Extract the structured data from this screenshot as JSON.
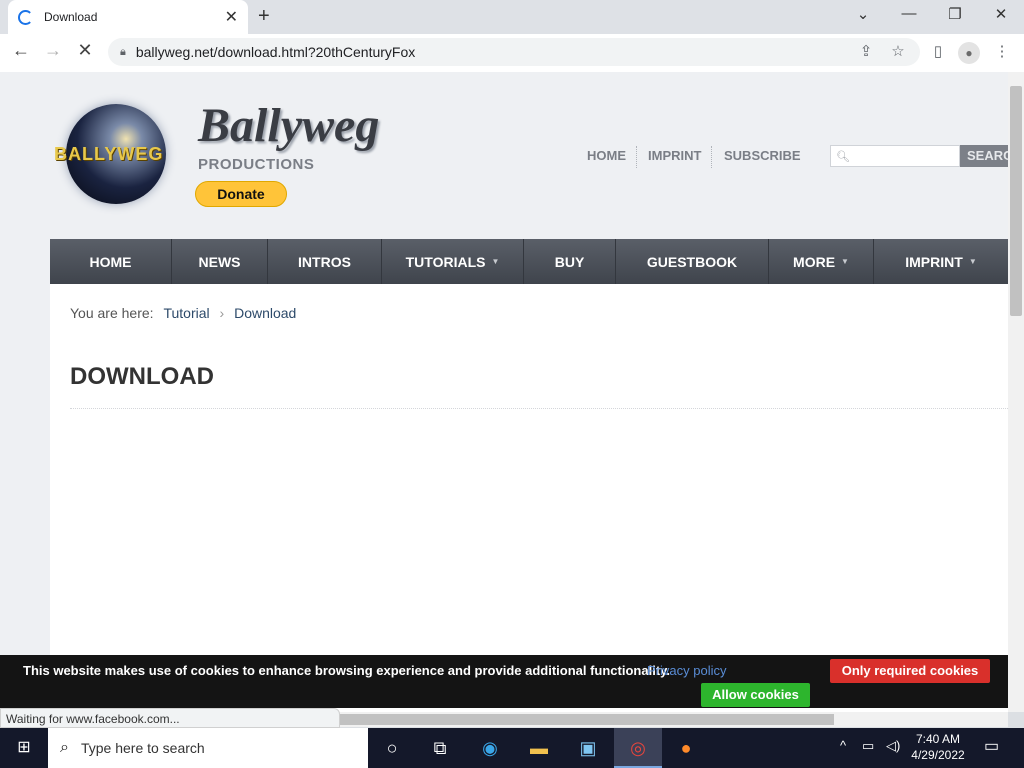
{
  "browser": {
    "tab_title": "Download",
    "tab_close": "✕",
    "new_tab": "+",
    "url": "ballyweg.net/download.html?20thCenturyFox",
    "status": "Waiting for www.facebook.com..."
  },
  "header": {
    "logo_text": "BALLYWEG",
    "brand": "Ballyweg",
    "brand_sub": "PRODUCTIONS",
    "donate": "Donate",
    "links": [
      "HOME",
      "IMPRINT",
      "SUBSCRIBE"
    ],
    "search_placeholder": "",
    "search_button": "SEARCH"
  },
  "nav": {
    "items": [
      {
        "label": "HOME",
        "dropdown": false
      },
      {
        "label": "NEWS",
        "dropdown": false
      },
      {
        "label": "INTROS",
        "dropdown": false
      },
      {
        "label": "TUTORIALS",
        "dropdown": true
      },
      {
        "label": "BUY",
        "dropdown": false
      },
      {
        "label": "GUESTBOOK",
        "dropdown": false
      },
      {
        "label": "MORE",
        "dropdown": true
      },
      {
        "label": "IMPRINT",
        "dropdown": true
      }
    ]
  },
  "breadcrumb": {
    "prefix": "You are here:",
    "items": [
      "Tutorial",
      "Download"
    ],
    "separator": "›"
  },
  "main": {
    "heading": "DOWNLOAD"
  },
  "cookie_bar": {
    "message": "This website makes use of cookies to enhance browsing experience and provide additional functionality.",
    "privacy": "Privacy policy",
    "only_required": "Only required cookies",
    "allow": "Allow cookies"
  },
  "taskbar": {
    "search_text": "Type here to search",
    "time": "7:40 AM",
    "date": "4/29/2022"
  },
  "colors": {
    "nav_bg": "#4a4f57",
    "donate": "#ffc439",
    "cookie_red": "#d9302b",
    "cookie_green": "#2db52d",
    "link_blue": "#2d4a6a"
  },
  "icons": [
    "spinner-icon",
    "back-arrow-icon",
    "forward-arrow-icon",
    "stop-loading-icon",
    "lock-icon",
    "share-icon",
    "star-icon",
    "sidepanel-icon",
    "profile-icon",
    "menu-dots-icon",
    "search-icon",
    "windows-start-icon",
    "cortana-icon",
    "task-view-icon",
    "edge-icon",
    "file-explorer-icon",
    "store-icon",
    "chrome-icon",
    "firefox-icon",
    "chevron-up-icon",
    "network-icon",
    "volume-icon",
    "notification-icon"
  ]
}
